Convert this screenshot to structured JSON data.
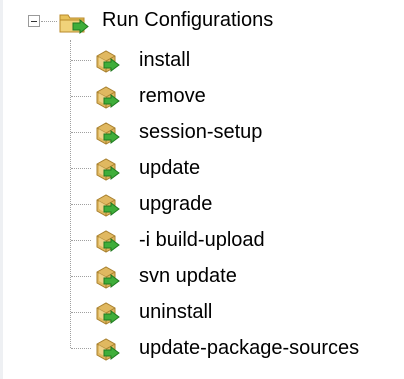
{
  "tree": {
    "root": {
      "label": "Run Configurations",
      "icon": "run-configurations-folder-icon",
      "expanded": true
    },
    "children": [
      {
        "label": "install",
        "icon": "launch-config-icon"
      },
      {
        "label": "remove",
        "icon": "launch-config-icon"
      },
      {
        "label": "session-setup",
        "icon": "launch-config-icon"
      },
      {
        "label": "update",
        "icon": "launch-config-icon"
      },
      {
        "label": "upgrade",
        "icon": "launch-config-icon"
      },
      {
        "label": "-i build-upload",
        "icon": "launch-config-icon"
      },
      {
        "label": "svn update",
        "icon": "launch-config-icon"
      },
      {
        "label": "uninstall",
        "icon": "launch-config-icon"
      },
      {
        "label": "update-package-sources",
        "icon": "launch-config-icon"
      }
    ]
  },
  "colors": {
    "folder": "#e8c25a",
    "folder_dark": "#b8892a",
    "box": "#e0b860",
    "box_light": "#f3dc9a",
    "arrow": "#3fae3a",
    "arrow_dark": "#1f7a20",
    "connector": "#a0a0a0"
  }
}
